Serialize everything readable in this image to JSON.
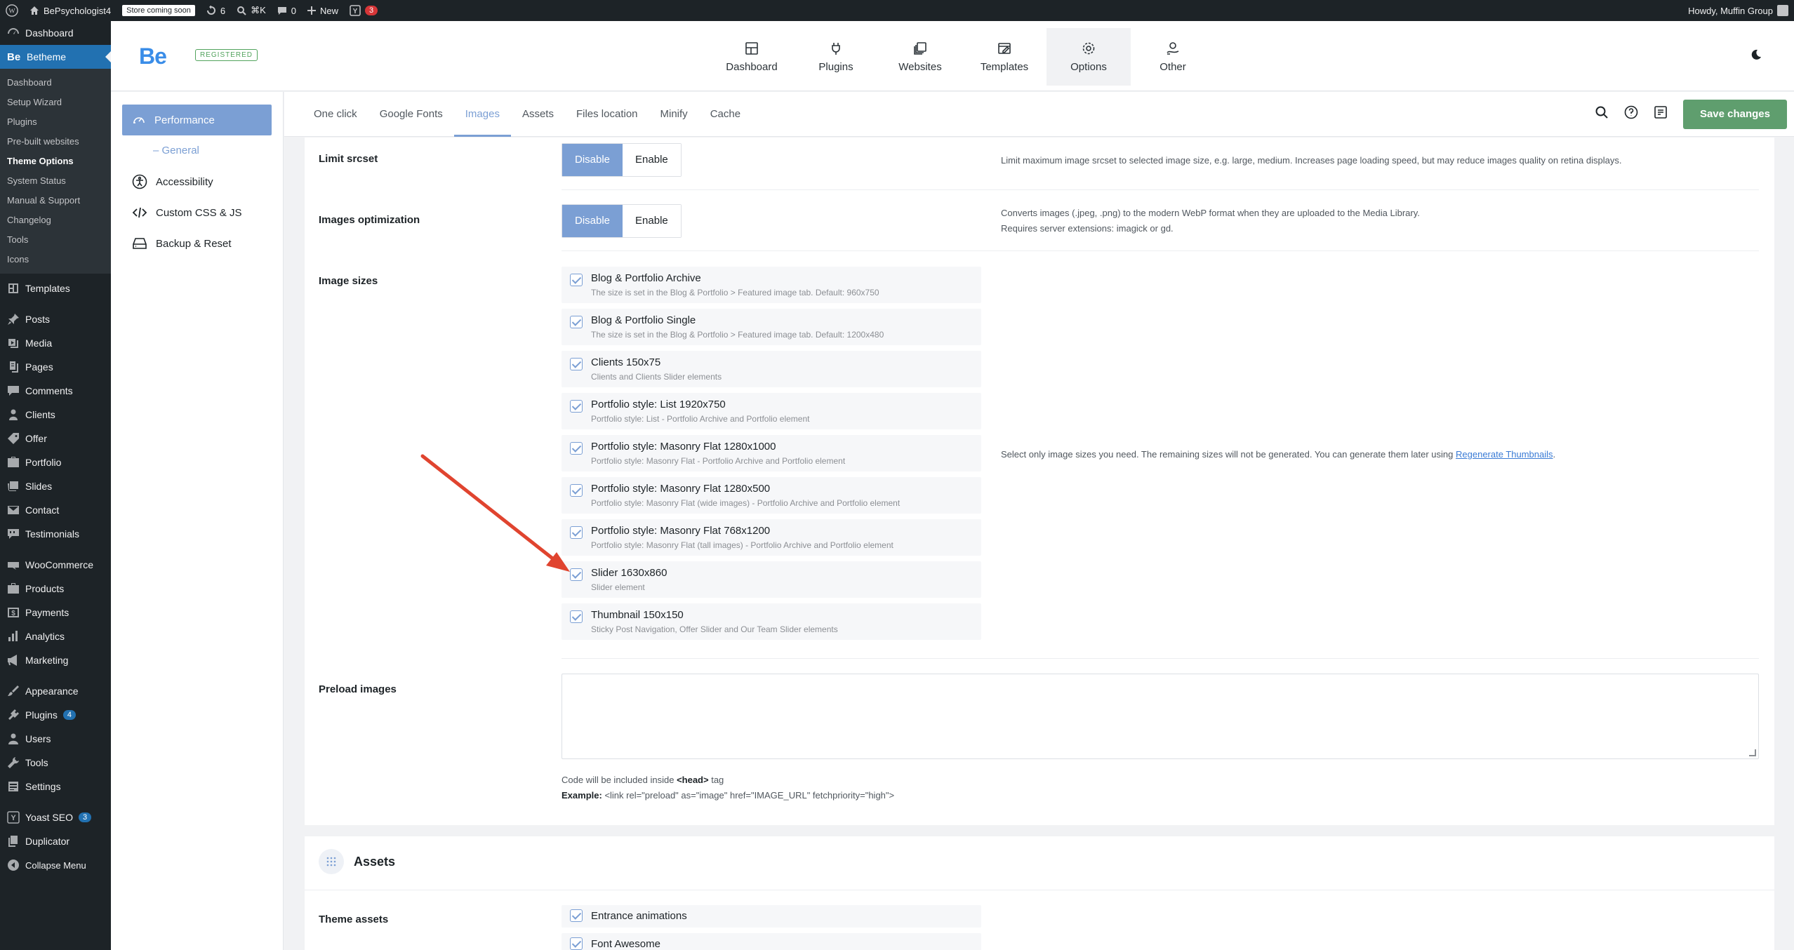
{
  "adminbar": {
    "site_name": "BePsychologist4",
    "store_badge": "Store coming soon",
    "updates_count": "6",
    "shortcut": "⌘K",
    "comments_count": "0",
    "new_label": "New",
    "yoast_count": "3",
    "howdy": "Howdy, Muffin Group"
  },
  "adminmenu": {
    "dashboard": "Dashboard",
    "betheme": "Betheme",
    "sub": [
      "Dashboard",
      "Setup Wizard",
      "Plugins",
      "Pre-built websites",
      "Theme Options",
      "System Status",
      "Manual & Support",
      "Changelog",
      "Tools",
      "Icons"
    ],
    "templates": "Templates",
    "group1": [
      "Posts",
      "Media",
      "Pages",
      "Comments",
      "Clients",
      "Offer",
      "Portfolio",
      "Slides",
      "Contact",
      "Testimonials"
    ],
    "group2": [
      "WooCommerce",
      "Products",
      "Payments",
      "Analytics",
      "Marketing"
    ],
    "appearance": "Appearance",
    "plugins": "Plugins",
    "plugins_badge": "4",
    "users": "Users",
    "tools": "Tools",
    "settings": "Settings",
    "yoast": "Yoast SEO",
    "yoast_badge": "3",
    "duplicator": "Duplicator",
    "collapse": "Collapse Menu"
  },
  "header": {
    "logo": "Be",
    "registered": "REGISTERED",
    "nav": [
      "Dashboard",
      "Plugins",
      "Websites",
      "Templates",
      "Options",
      "Other"
    ]
  },
  "sidebar": {
    "performance": "Performance",
    "general": "– General",
    "accessibility": "Accessibility",
    "custom_css": "Custom CSS & JS",
    "backup": "Backup & Reset"
  },
  "tabs": [
    "One click",
    "Google Fonts",
    "Images",
    "Assets",
    "Files location",
    "Minify",
    "Cache"
  ],
  "save_label": "Save changes",
  "options": {
    "limit_srcset": {
      "label": "Limit srcset",
      "disable": "Disable",
      "enable": "Enable",
      "desc": "Limit maximum image srcset to selected image size, e.g. large, medium. Increases page loading speed, but may reduce images quality on retina displays."
    },
    "images_opt": {
      "label": "Images optimization",
      "disable": "Disable",
      "enable": "Enable",
      "desc1": "Converts images (.jpeg, .png) to the modern WebP format when they are uploaded to the Media Library.",
      "desc2": "Requires server extensions: imagick or gd."
    },
    "image_sizes": {
      "label": "Image sizes",
      "desc": "Select only image sizes you need. The remaining sizes will not be generated. You can generate them later using",
      "link": "Regenerate Thumbnails",
      "items": [
        {
          "title": "Blog & Portfolio Archive",
          "desc": "The size is set in the Blog & Portfolio > Featured image tab. Default: 960x750"
        },
        {
          "title": "Blog & Portfolio Single",
          "desc": "The size is set in the Blog & Portfolio > Featured image tab. Default: 1200x480"
        },
        {
          "title": "Clients 150x75",
          "desc": "Clients and Clients Slider elements"
        },
        {
          "title": "Portfolio style: List 1920x750",
          "desc": "Portfolio style: List - Portfolio Archive and Portfolio element"
        },
        {
          "title": "Portfolio style: Masonry Flat 1280x1000",
          "desc": "Portfolio style: Masonry Flat - Portfolio Archive and Portfolio element"
        },
        {
          "title": "Portfolio style: Masonry Flat 1280x500",
          "desc": "Portfolio style: Masonry Flat (wide images) - Portfolio Archive and Portfolio element"
        },
        {
          "title": "Portfolio style: Masonry Flat 768x1200",
          "desc": "Portfolio style: Masonry Flat (tall images) - Portfolio Archive and Portfolio element"
        },
        {
          "title": "Slider 1630x860",
          "desc": "Slider element"
        },
        {
          "title": "Thumbnail 150x150",
          "desc": "Sticky Post Navigation, Offer Slider and Our Team Slider elements"
        }
      ]
    },
    "preload": {
      "label": "Preload images",
      "hint_pre": "Code will be included inside",
      "hint_tag": "<head>",
      "hint_post": "tag",
      "example_label": "Example:",
      "example": "<link rel=\"preload\" as=\"image\" href=\"IMAGE_URL\" fetchpriority=\"high\">"
    }
  },
  "assets_section": {
    "title": "Assets",
    "theme_assets": "Theme assets",
    "items": [
      "Entrance animations",
      "Font Awesome"
    ]
  }
}
